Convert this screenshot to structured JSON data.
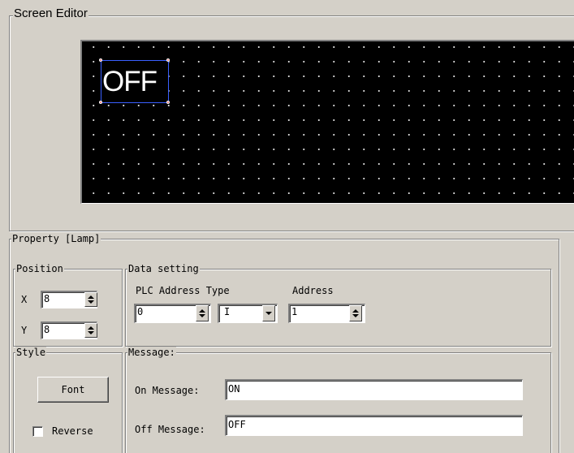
{
  "screen_editor": {
    "title": "Screen Editor",
    "lamp_text": "OFF"
  },
  "property": {
    "title": "Property  [Lamp]",
    "position": {
      "title": "Position",
      "x_label": "X",
      "x_value": "8",
      "y_label": "Y",
      "y_value": "8"
    },
    "data_setting": {
      "title": "Data setting",
      "plc_label": "PLC Address Type",
      "address_label": "Address",
      "plc_value": "0",
      "type_value": "I",
      "address_value": "1"
    },
    "style": {
      "title": "Style",
      "font_button": "Font",
      "reverse_label": "Reverse",
      "reverse_checked": false
    },
    "message": {
      "title": "Message:",
      "on_label": "On Message:",
      "on_value": "ON",
      "off_label": "Off Message:",
      "off_value": "OFF"
    }
  },
  "colors": {
    "dialog_bg": "#d4d0c8",
    "screen_bg": "#000000",
    "selection": "#3a5fff"
  },
  "icons": {
    "spin": "spin-buttons-icon",
    "dropdown": "chevron-down-icon"
  }
}
